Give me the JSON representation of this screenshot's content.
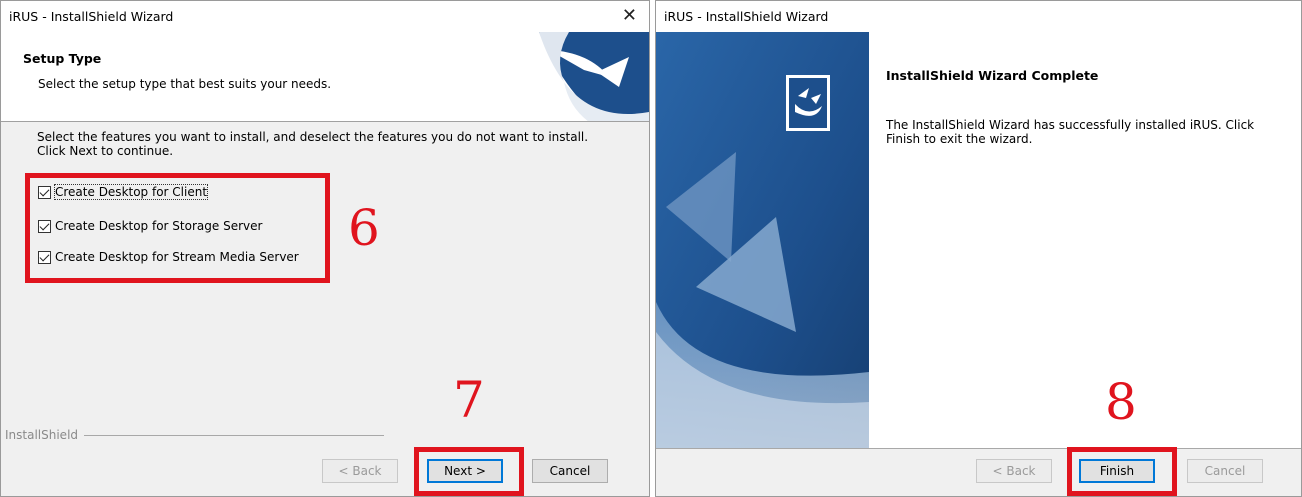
{
  "left_dialog": {
    "title": "iRUS - InstallShield Wizard",
    "close_glyph": "✕",
    "header_title": "Setup Type",
    "header_subtitle": "Select the setup type that best suits your needs.",
    "instructions": "Select the features you want to install, and deselect the features you do not want to install.  Click Next to continue.",
    "options": [
      {
        "label": "Create Desktop for Client",
        "checked": true
      },
      {
        "label": "Create Desktop for Storage Server",
        "checked": true
      },
      {
        "label": "Create Desktop for Stream Media Server",
        "checked": true
      }
    ],
    "brand": "InstallShield",
    "buttons": {
      "back": "< Back",
      "next": "Next >",
      "cancel": "Cancel"
    },
    "annotations": {
      "options_step": "6",
      "next_step": "7"
    }
  },
  "right_dialog": {
    "title": "iRUS - InstallShield Wizard",
    "complete_title": "InstallShield Wizard Complete",
    "complete_message": "The InstallShield Wizard has successfully installed iRUS.  Click Finish to exit the wizard.",
    "buttons": {
      "back": "< Back",
      "finish": "Finish",
      "cancel": "Cancel"
    },
    "annotations": {
      "finish_step": "8"
    }
  },
  "colors": {
    "annotation_red": "#e0141e",
    "accent_blue": "#0078d7",
    "art_blue": "#1d4f8c"
  }
}
